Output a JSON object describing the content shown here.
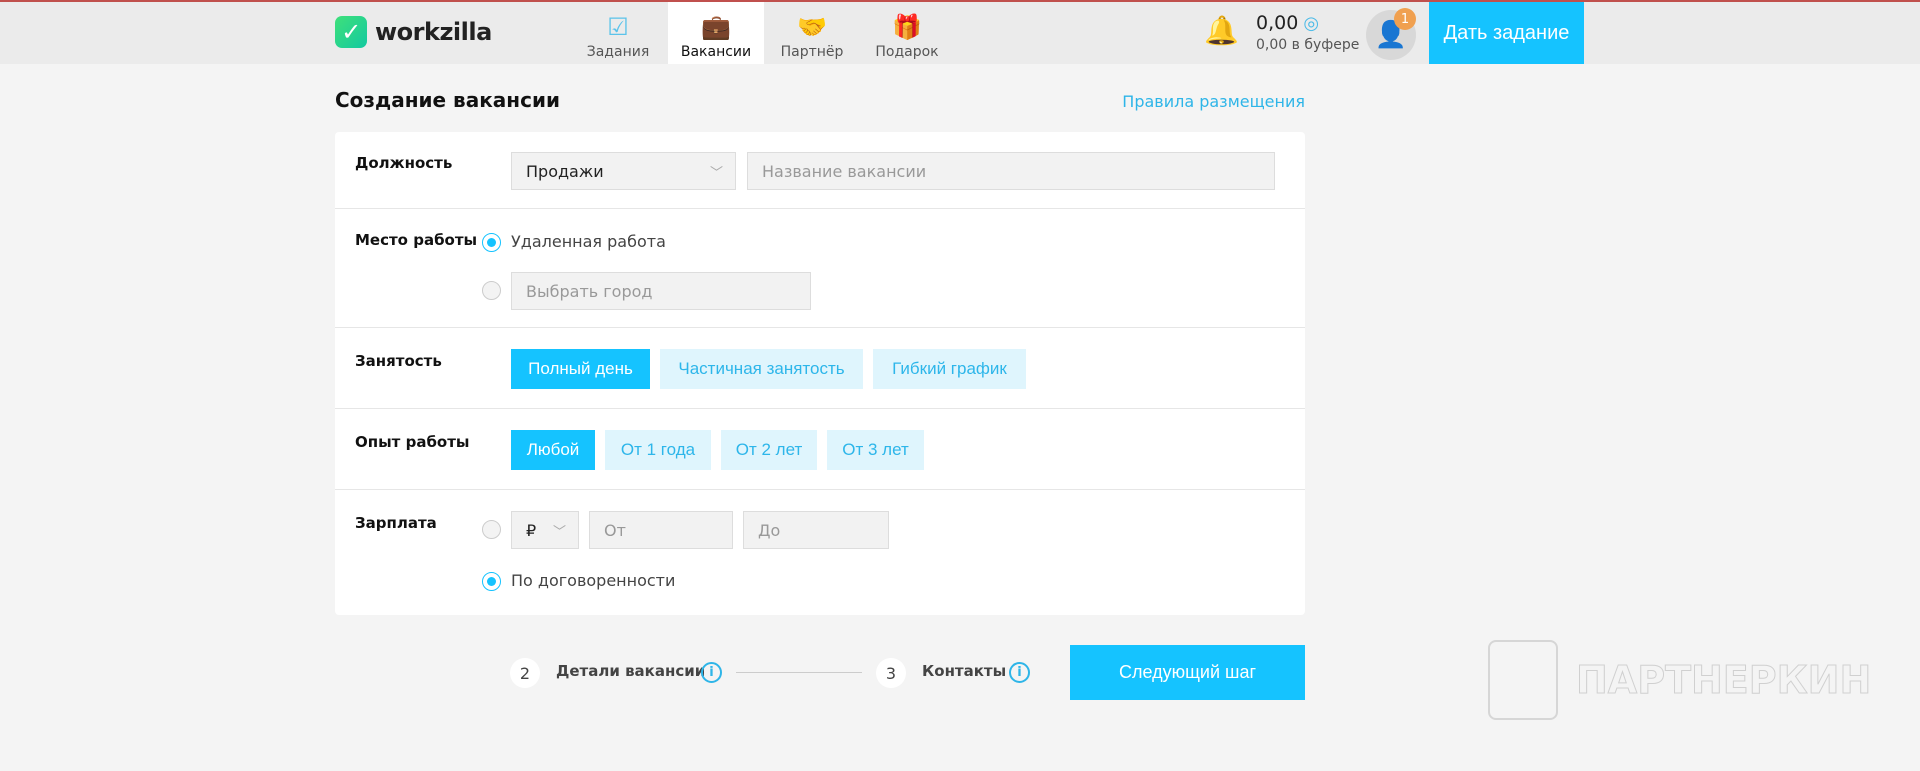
{
  "header": {
    "logo": "workzilla",
    "tabs": [
      {
        "label": "Задания",
        "icon": "checkbox-icon"
      },
      {
        "label": "Вакансии",
        "icon": "briefcase-icon",
        "active": true
      },
      {
        "label": "Партнёр",
        "icon": "handshake-icon"
      },
      {
        "label": "Подарок",
        "icon": "gift-icon"
      }
    ],
    "balance": "0,00",
    "buffer": "0,00 в буфере",
    "notification_count": "1",
    "give_task": "Дать задание"
  },
  "page": {
    "title": "Создание вакансии",
    "rules_link": "Правила размещения"
  },
  "form": {
    "position": {
      "label": "Должность",
      "category": "Продажи",
      "name_placeholder": "Название вакансии"
    },
    "location": {
      "label": "Место работы",
      "remote": "Удаленная работа",
      "city_placeholder": "Выбрать город",
      "selected": "remote"
    },
    "employment": {
      "label": "Занятость",
      "options": [
        "Полный день",
        "Частичная занятость",
        "Гибкий график"
      ],
      "selected": "Полный день"
    },
    "experience": {
      "label": "Опыт работы",
      "options": [
        "Любой",
        "От 1 года",
        "От 2 лет",
        "От 3 лет"
      ],
      "selected": "Любой"
    },
    "salary": {
      "label": "Зарплата",
      "currency": "₽",
      "from_placeholder": "От",
      "to_placeholder": "До",
      "negotiable": "По договоренности",
      "selected": "negotiable"
    }
  },
  "steps": [
    {
      "num": "2",
      "label": "Детали вакансии"
    },
    {
      "num": "3",
      "label": "Контакты"
    }
  ],
  "next_button": "Следующий шаг",
  "watermark": "ПАРТНЕРКИН",
  "colors": {
    "accent": "#15c3ff",
    "chip_bg": "#dff5fd",
    "badge": "#f0a050"
  }
}
